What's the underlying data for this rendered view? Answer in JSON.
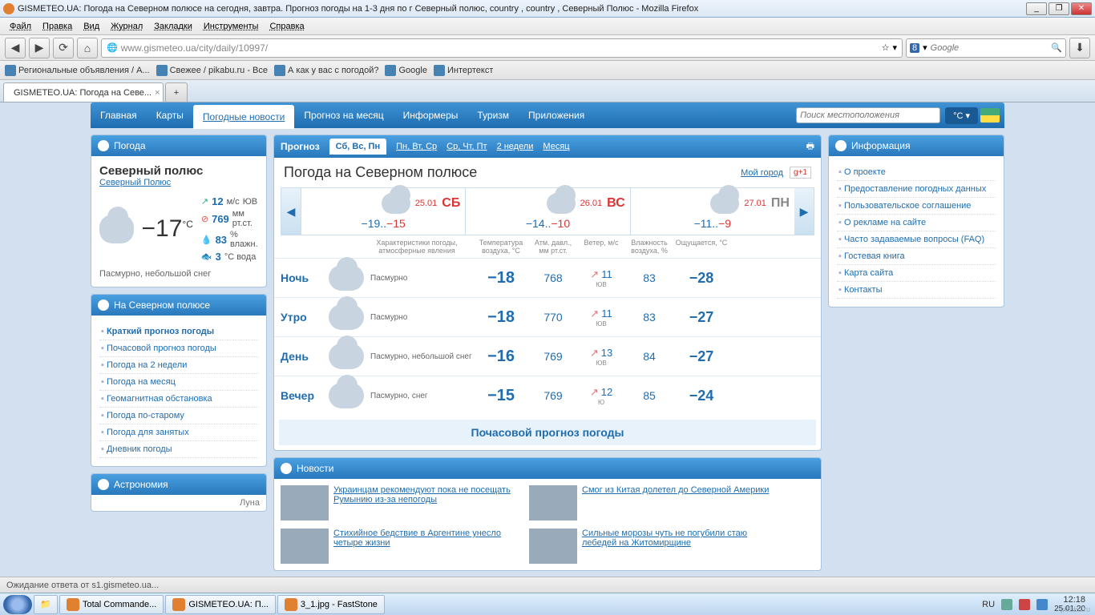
{
  "window": {
    "title": "GISMETEO.UA: Погода на Северном полюсе на сегодня, завтра. Прогноз погоды на 1-3 дня по г Северный полюс, country , country , Северный Полюс - Mozilla Firefox"
  },
  "menu": [
    "Файл",
    "Правка",
    "Вид",
    "Журнал",
    "Закладки",
    "Инструменты",
    "Справка"
  ],
  "nav": {
    "url": "www.gismeteo.ua/city/daily/10997/",
    "search_ph": "Google",
    "search_engine": "8"
  },
  "bookmarks": [
    "Региональные объявления / А...",
    "Свежее / pikabu.ru - Все",
    "А как у вас с погодой?",
    "Google",
    "Интертекст"
  ],
  "tabs": [
    "GISMETEO.UA: Погода на Севе..."
  ],
  "sitenav": {
    "items": [
      "Главная",
      "Карты",
      "Погодные новости",
      "Прогноз на месяц",
      "Информеры",
      "Туризм",
      "Приложения"
    ],
    "loc_ph": "Поиск местоположения",
    "unit": "°C ▾"
  },
  "leftWeather": {
    "head": "Погода",
    "city": "Северный полюс",
    "citylink": "Северный Полюс",
    "temp": "−17",
    "wind_v": "12",
    "wind_u": "м/с",
    "wind_d": "ЮВ",
    "press": "769",
    "press_u": "мм рт.ст.",
    "hum": "83",
    "hum_u": "% влажн.",
    "water": "3",
    "water_u": "°C вода",
    "cond": "Пасмурно, небольшой снег"
  },
  "leftLocal": {
    "head": "На Северном полюсе",
    "items": [
      "Краткий прогноз погоды",
      "Почасовой прогноз погоды",
      "Погода на 2 недели",
      "Погода на месяц",
      "Геомагнитная обстановка",
      "Погода по-старому",
      "Погода для занятых",
      "Дневник погоды"
    ]
  },
  "astro": {
    "head": "Астрономия",
    "moon": "Луна"
  },
  "forecast": {
    "head": "Прогноз",
    "tabs": [
      "Сб, Вс, Пн",
      "Пн, Вт, Ср",
      "Ср, Чт, Пт",
      "2 недели",
      "Месяц"
    ],
    "title": "Погода на Северном полюсе",
    "mycity": "Мой город",
    "gplus": "g+1",
    "days": [
      {
        "date": "25.01",
        "name": "СБ",
        "red": true,
        "lo": "−19",
        "hi": "−15"
      },
      {
        "date": "26.01",
        "name": "ВС",
        "red": true,
        "lo": "−14",
        "hi": "−10"
      },
      {
        "date": "27.01",
        "name": "ПН",
        "red": false,
        "lo": "−11",
        "hi": "−9"
      }
    ],
    "cols": [
      "Характеристики погоды, атмосферные явления",
      "Температура воздуха, °C",
      "Атм. давл., мм рт.ст.",
      "Ветер, м/с",
      "Влажность воздуха, %",
      "Ощущается, °C"
    ],
    "rows": [
      {
        "part": "Ночь",
        "cond": "Пасмурно",
        "t": "−18",
        "p": "768",
        "w": "11",
        "wd": "ЮВ",
        "h": "83",
        "f": "−28"
      },
      {
        "part": "Утро",
        "cond": "Пасмурно",
        "t": "−18",
        "p": "770",
        "w": "11",
        "wd": "ЮВ",
        "h": "83",
        "f": "−27"
      },
      {
        "part": "День",
        "cond": "Пасмурно, небольшой снег",
        "t": "−16",
        "p": "769",
        "w": "13",
        "wd": "ЮВ",
        "h": "84",
        "f": "−27"
      },
      {
        "part": "Вечер",
        "cond": "Пасмурно, снег",
        "t": "−15",
        "p": "769",
        "w": "12",
        "wd": "Ю",
        "h": "85",
        "f": "−24"
      }
    ],
    "hourly": "Почасовой прогноз погоды"
  },
  "news": {
    "head": "Новости",
    "items": [
      "Украинцам рекомендуют пока не посещать Румынию из-за непогоды",
      "Смог из Китая долетел до Северной Америки",
      "Стихийное бедствие в Аргентине унесло четыре жизни",
      "Сильные морозы чуть не погубили стаю лебедей на Житомирщине"
    ]
  },
  "info": {
    "head": "Информация",
    "items": [
      "О проекте",
      "Предоставление погодных данных",
      "Пользовательское соглашение",
      "О рекламе на сайте",
      "Часто задаваемые вопросы (FAQ)",
      "Гостевая книга",
      "Карта сайта",
      "Контакты"
    ]
  },
  "status": "Ожидание ответа от s1.gismeteo.ua...",
  "taskbar": {
    "items": [
      "Total Commande...",
      "GISMETEO.UA: П...",
      "3_1.jpg - FastStone"
    ],
    "lang": "RU",
    "time": "12:18",
    "date": "25.01.20"
  },
  "watermark": "pikabu.ru"
}
